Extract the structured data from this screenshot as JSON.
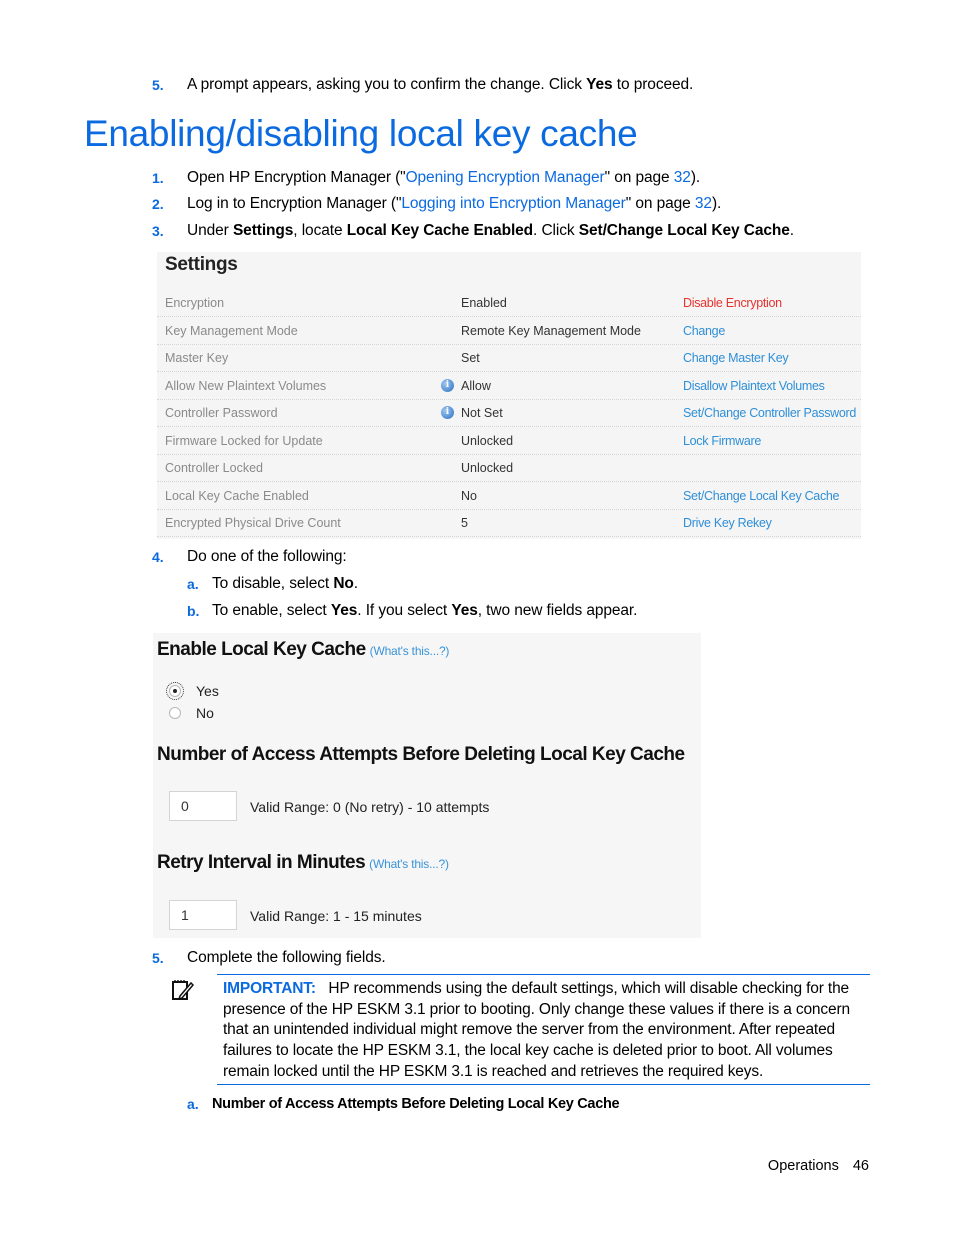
{
  "prev_step": {
    "number": "5.",
    "text_before": "A prompt appears, asking you to confirm the change. Click ",
    "bold": "Yes",
    "text_after": " to proceed."
  },
  "section_title": "Enabling/disabling local key cache",
  "steps": [
    {
      "number": "1.",
      "text_before": "Open HP Encryption Manager (\"",
      "link": "Opening Encryption Manager",
      "text_mid": "\" on page ",
      "page_link": "32",
      "text_after": ")."
    },
    {
      "number": "2.",
      "text_before": "Log in to Encryption Manager (\"",
      "link": "Logging into Encryption Manager",
      "text_mid": "\" on page ",
      "page_link": "32",
      "text_after": ")."
    },
    {
      "number": "3.",
      "parts": [
        "Under ",
        "Settings",
        ", locate ",
        "Local Key Cache Enabled",
        ". Click ",
        "Set/Change Local Key Cache",
        "."
      ]
    }
  ],
  "settings_panel": {
    "title": "Settings",
    "rows": [
      {
        "key": "Encryption",
        "info": false,
        "value": "Enabled",
        "action": "Disable Encryption",
        "action_color": "#e8322e"
      },
      {
        "key": "Key Management Mode",
        "info": false,
        "value": "Remote Key Management Mode",
        "action": "Change"
      },
      {
        "key": "Master Key",
        "info": false,
        "value": "Set",
        "action": "Change Master Key"
      },
      {
        "key": "Allow New Plaintext Volumes",
        "info": true,
        "value": "Allow",
        "action": "Disallow Plaintext Volumes"
      },
      {
        "key": "Controller Password",
        "info": true,
        "value": "Not Set",
        "action": "Set/Change Controller Password"
      },
      {
        "key": "Firmware Locked for Update",
        "info": false,
        "value": "Unlocked",
        "action": "Lock Firmware"
      },
      {
        "key": "Controller Locked",
        "info": false,
        "value": "Unlocked",
        "action": ""
      },
      {
        "key": "Local Key Cache Enabled",
        "info": false,
        "value": "No",
        "action": "Set/Change Local Key Cache"
      },
      {
        "key": "Encrypted Physical Drive Count",
        "info": false,
        "value": "5",
        "action": "Drive Key Rekey"
      }
    ],
    "info_icon_glyph": "i"
  },
  "step4": {
    "number": "4.",
    "text": "Do one of the following:",
    "subs": [
      {
        "letter": "a.",
        "parts": [
          "To disable, select ",
          "No",
          "."
        ]
      },
      {
        "letter": "b.",
        "parts": [
          "To enable, select ",
          "Yes",
          ". If you select ",
          "Yes",
          ", two new fields appear."
        ]
      }
    ]
  },
  "lkc_form": {
    "enable_heading": "Enable Local Key Cache",
    "whats_this": "(What's this...?)",
    "options": [
      {
        "label": "Yes",
        "checked": true
      },
      {
        "label": "No",
        "checked": false
      }
    ],
    "attempts_heading": "Number of Access Attempts Before Deleting Local Key Cache",
    "attempts_value": "0",
    "attempts_range": "Valid Range: 0 (No retry) - 10 attempts",
    "interval_heading": "Retry Interval in Minutes",
    "interval_whats_this": "(What's this...?)",
    "interval_value": "1",
    "interval_range": "Valid Range: 1 - 15 minutes"
  },
  "step5": {
    "number": "5.",
    "text": "Complete the following fields."
  },
  "important": {
    "icon": "notepad-pencil-icon",
    "label": "IMPORTANT:",
    "text": "HP recommends using the default settings, which will disable checking for the presence of the HP ESKM 3.1 prior to booting. Only change these values if there is a concern that an unintended individual might remove the server from the environment. After repeated failures to locate the HP ESKM 3.1, the local key cache is deleted prior to boot. All volumes remain locked until the HP ESKM 3.1 is reached and retrieves the required keys."
  },
  "step5a": {
    "letter": "a.",
    "text": "Number of Access Attempts Before Deleting Local Key Cache"
  },
  "footer": {
    "section": "Operations",
    "page": "46"
  }
}
